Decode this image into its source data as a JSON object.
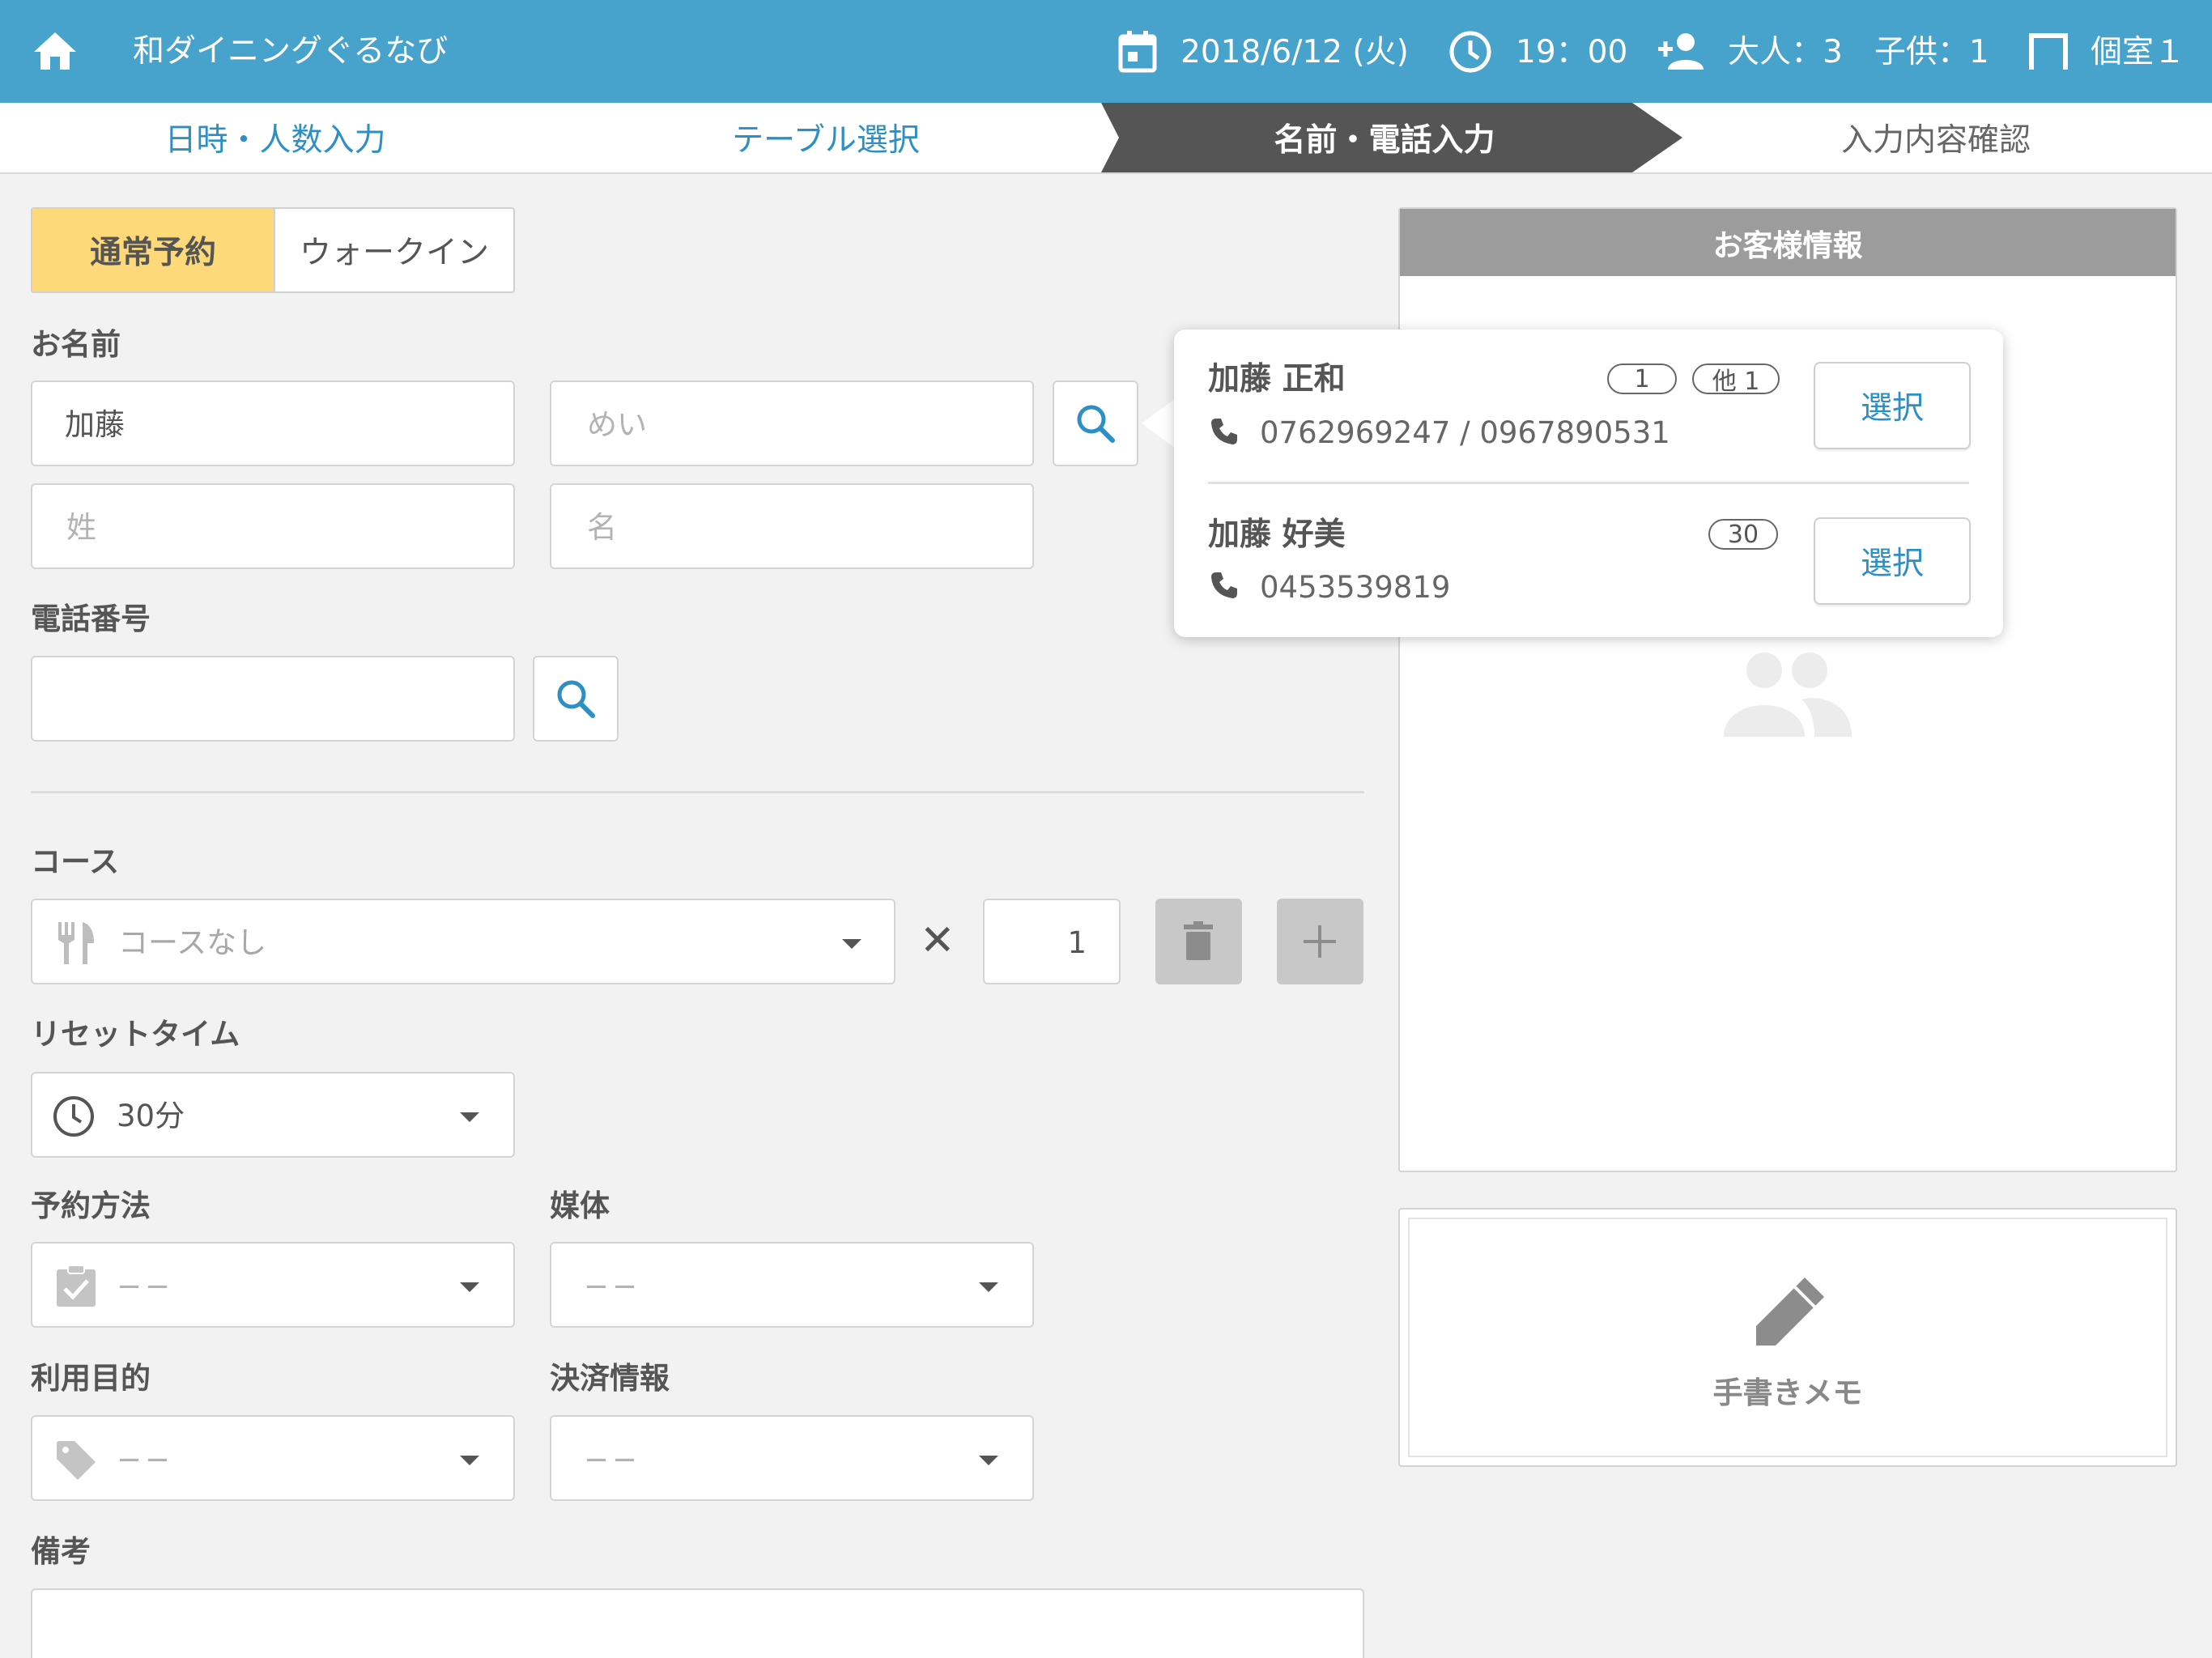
{
  "header": {
    "store_name": "和ダイニングぐるなび",
    "date": "2018/6/12 (火)",
    "time": "19：00",
    "party": "大人：3　子供：1",
    "room": "個室１"
  },
  "steps": [
    {
      "label": "日時・人数入力",
      "state": "done"
    },
    {
      "label": "テーブル選択",
      "state": "done"
    },
    {
      "label": "名前・電話入力",
      "state": "active"
    },
    {
      "label": "入力内容確認",
      "state": "pending"
    }
  ],
  "reservation_type": {
    "normal_label": "通常予約",
    "walkin_label": "ウォークイン",
    "selected": "通常予約"
  },
  "name": {
    "label": "お名前",
    "kana_last_value": "加藤",
    "kana_first_placeholder": "めい",
    "last_placeholder": "姓",
    "first_placeholder": "名"
  },
  "phone": {
    "label": "電話番号",
    "value": ""
  },
  "course": {
    "label": "コース",
    "value": "コースなし",
    "times": "✕",
    "quantity": "1"
  },
  "reset_time": {
    "label": "リセットタイム",
    "value": "30分"
  },
  "booking_method": {
    "label": "予約方法",
    "value": "−−"
  },
  "media": {
    "label": "媒体",
    "value": "−−"
  },
  "purpose": {
    "label": "利用目的",
    "value": "−−"
  },
  "payment": {
    "label": "決済情報",
    "value": "−−"
  },
  "notes": {
    "label": "備考",
    "value": ""
  },
  "customer_panel": {
    "title": "お客様情報"
  },
  "memo": {
    "label": "手書きメモ"
  },
  "search_results": [
    {
      "name": "加藤 正和",
      "badges": [
        "1",
        "他 1"
      ],
      "phone": "0762969247 / 0967890531",
      "select_label": "選択"
    },
    {
      "name": "加藤 好美",
      "badges": [
        "30"
      ],
      "phone": "0453539819",
      "select_label": "選択"
    }
  ],
  "colors": {
    "header_bg": "#47a2cc",
    "accent_blue": "#2e8fc5",
    "active_step_bg": "#555555",
    "selected_tab_bg": "#fdd97a"
  }
}
